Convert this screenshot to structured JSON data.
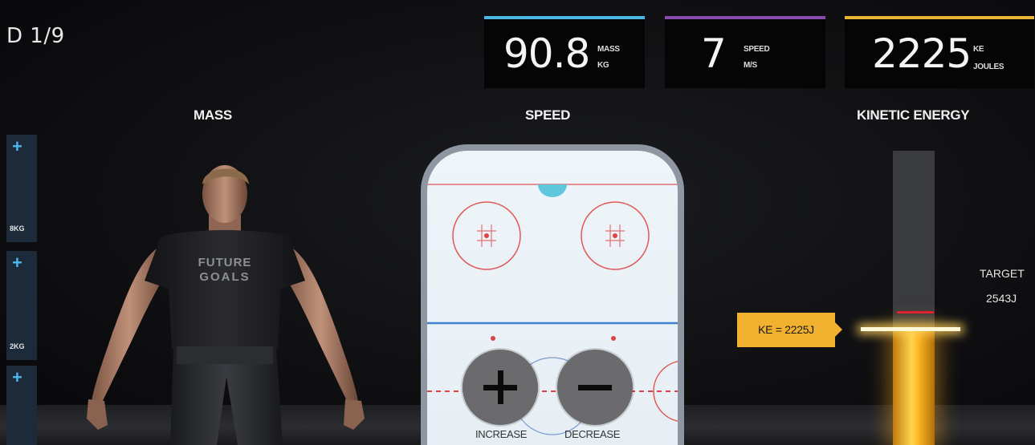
{
  "level": {
    "label": "D 1/9"
  },
  "stats": {
    "mass": {
      "value": "90.8",
      "unit_top": "MASS",
      "unit_bottom": "KG",
      "color": "#48b7e5"
    },
    "speed": {
      "value": "7",
      "unit_top": "SPEED",
      "unit_bottom": "M/S",
      "color": "#8a4ab0"
    },
    "kinetic_energy": {
      "value": "2225",
      "unit_top": "KE",
      "unit_bottom": "JOULES",
      "color": "#e9b431"
    }
  },
  "sections": {
    "mass": "MASS",
    "speed": "SPEED",
    "kinetic_energy": "KINETIC ENERGY"
  },
  "mass_selector": {
    "slots": [
      {
        "plus": "+",
        "label": "8KG"
      },
      {
        "plus": "+",
        "label": "2KG"
      },
      {
        "plus": "+",
        "label": ""
      }
    ]
  },
  "character": {
    "shirt_line1": "FUTURE",
    "shirt_line2": "GOALS"
  },
  "speed_controls": {
    "increase_label": "INCREASE",
    "decrease_label": "DECREASE"
  },
  "ke_meter": {
    "tag": "KE = 2225J",
    "target_label": "TARGET",
    "target_value": "2543J",
    "current_joules": 2225,
    "target_joules": 2543,
    "fill_color": "#ffb825",
    "target_color": "#e0212b"
  }
}
